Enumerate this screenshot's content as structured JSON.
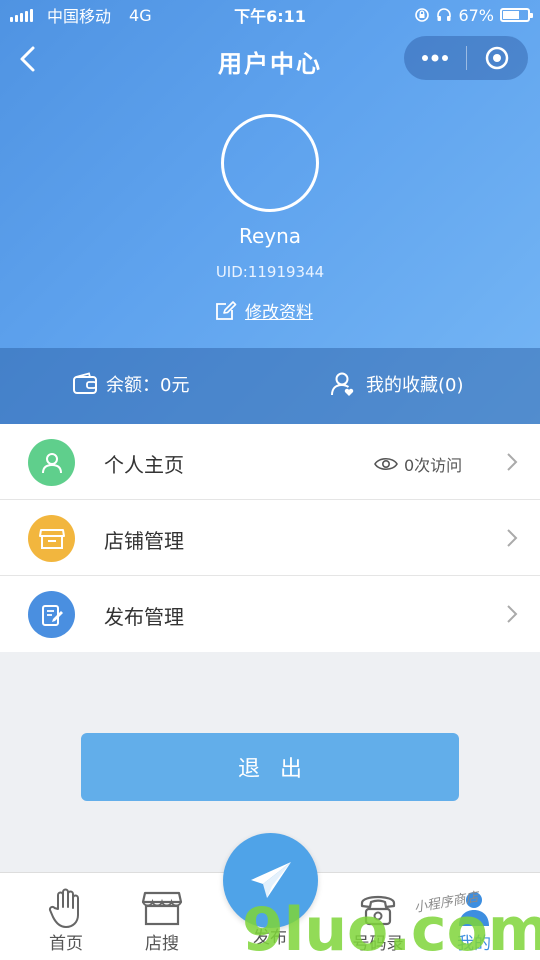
{
  "status_bar": {
    "carrier": "中国移动",
    "network": "4G",
    "time": "下午6:11",
    "battery_percent": "67%",
    "battery_level": 0.67
  },
  "nav": {
    "title": "用户中心"
  },
  "profile": {
    "username": "Reyna",
    "uid": "UID:11919344",
    "edit_label": "修改资料"
  },
  "account": {
    "balance_label": "余额：0元",
    "favorites_label": "我的收藏(0)"
  },
  "menu": {
    "items": [
      {
        "label": "个人主页",
        "extra": "0次访问",
        "icon": "person-icon",
        "color": "#5fcf8c"
      },
      {
        "label": "店铺管理",
        "icon": "store-icon",
        "color": "#f2b63e"
      },
      {
        "label": "发布管理",
        "icon": "edit-document-icon",
        "color": "#4a8fe0"
      }
    ]
  },
  "logout_label": "退出",
  "tabs": [
    {
      "label": "首页",
      "icon": "hand-icon"
    },
    {
      "label": "店搜",
      "icon": "store-icon"
    },
    {
      "label": "发布",
      "icon": "paper-plane-icon"
    },
    {
      "label": "号码录",
      "icon": "phone-icon"
    },
    {
      "label": "我的",
      "icon": "user-icon"
    }
  ],
  "watermark": {
    "text": "9luo.com",
    "subtext": "小程序商店"
  },
  "colors": {
    "accent": "#62aeea",
    "hero_gradient_start": "#4f93e2",
    "hero_gradient_end": "#75b6f5",
    "watermark": "#7fd53a"
  }
}
